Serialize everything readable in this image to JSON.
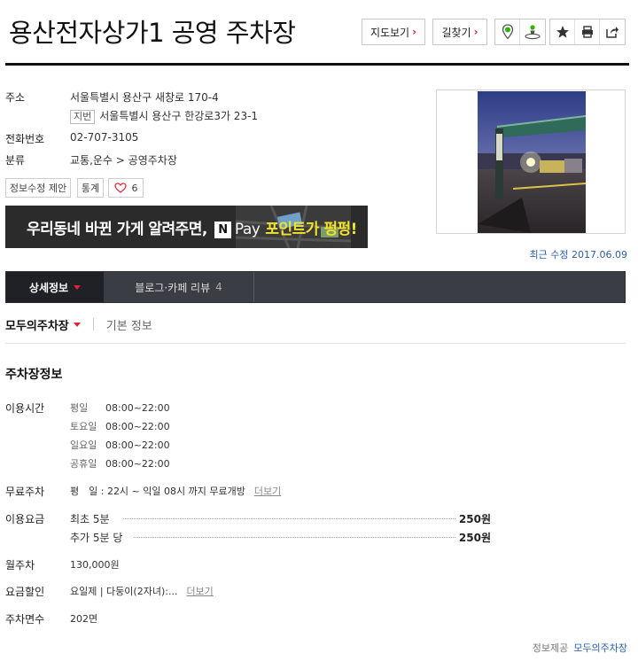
{
  "header": {
    "title": "용산전자상가1 공영 주차장",
    "map_button": "지도보기",
    "route_button": "길찾기",
    "icons": [
      "location-pin-icon",
      "street-view-icon",
      "star-icon",
      "print-icon",
      "share-icon"
    ]
  },
  "info": {
    "address_label": "주소",
    "address": "서울특별시 용산구 새창로 170-4",
    "jibun_tag": "지번",
    "jibun_address": "서울특별시 용산구 한강로3가 23-1",
    "phone_label": "전화번호",
    "phone": "02-707-3105",
    "category_label": "분류",
    "category": "교통,운수 > 공영주차장",
    "edit_button": "정보수정 제안",
    "stats_button": "통계",
    "like_count": "6"
  },
  "banner": {
    "text": "우리동네 바뀐 가게 알려주면,",
    "n_logo": "N",
    "pay": "Pay",
    "highlight": "포인트가 펑펑!"
  },
  "updated": "최근 수정 2017.06.09",
  "tabs": [
    {
      "label": "상세정보",
      "count": ""
    },
    {
      "label": "블로그·카페 리뷰",
      "count": "4"
    }
  ],
  "subtabs": {
    "active": "모두의주차장",
    "other": "기본 정보"
  },
  "parking": {
    "section_title": "주차장정보",
    "hours_label": "이용시간",
    "hours": [
      {
        "day": "평일",
        "time": "08:00~22:00"
      },
      {
        "day": "토요일",
        "time": "08:00~22:00"
      },
      {
        "day": "일요일",
        "time": "08:00~22:00"
      },
      {
        "day": "공휴일",
        "time": "08:00~22:00"
      }
    ],
    "free_label": "무료주차",
    "free_text": "평　일 : 22시 ~ 익일 08시 까지 무료개방",
    "more_label": "더보기",
    "fee_label": "이용요금",
    "fees": [
      {
        "name": "최초 5분",
        "price": "250원"
      },
      {
        "name": "추가 5분 당",
        "price": "250원"
      }
    ],
    "monthly_label": "월주차",
    "monthly": "130,000원",
    "discount_label": "요금할인",
    "discount": "요일제 | 다둥이(2자녀):...",
    "spaces_label": "주차면수",
    "spaces": "202면"
  },
  "footer": {
    "label": "정보제공",
    "source": "모두의주차장"
  }
}
